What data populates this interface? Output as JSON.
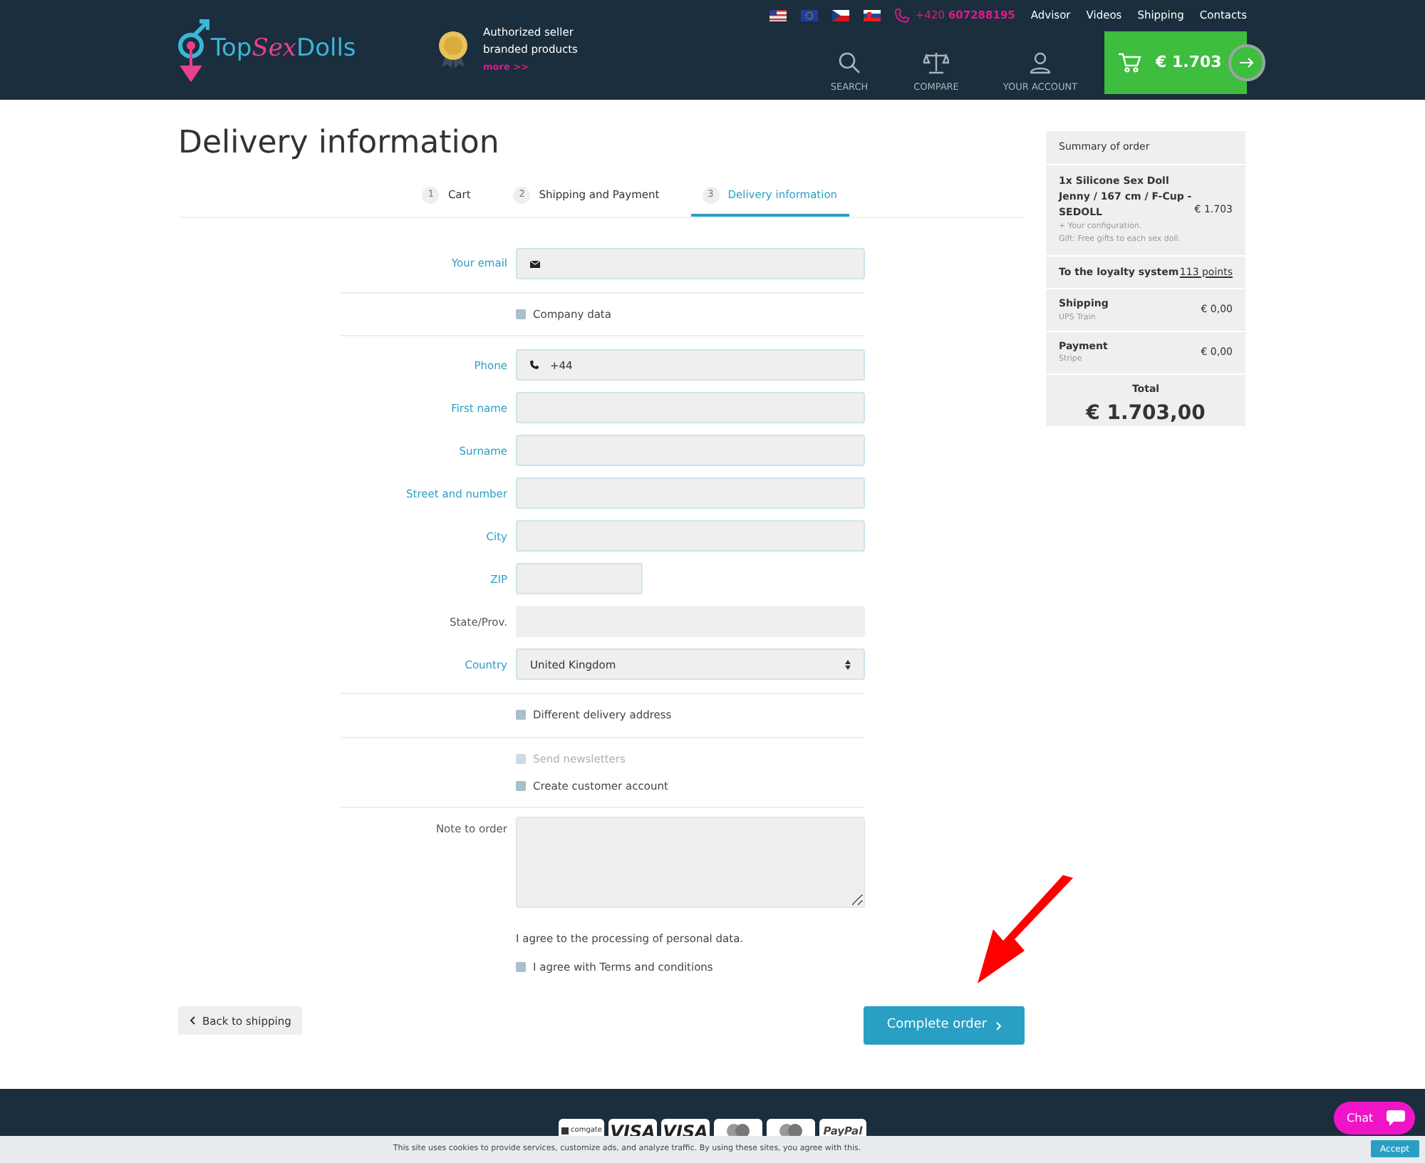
{
  "header": {
    "logo": [
      "Top",
      "Sex",
      "Dolls"
    ],
    "badge": {
      "lines": [
        "Authorized seller",
        "branded products"
      ],
      "link": "more >>"
    },
    "flags": [
      {
        "kind": "us"
      },
      {
        "kind": "eu"
      },
      {
        "kind": "cz"
      },
      {
        "kind": "sk"
      }
    ],
    "phone": {
      "prefix": "+420",
      "number": "607288195"
    },
    "nav_links": [
      "Advisor",
      "Videos",
      "Shipping",
      "Contacts"
    ],
    "actions": [
      {
        "kind": "search",
        "label": "SEARCH"
      },
      {
        "kind": "compare",
        "label": "COMPARE"
      },
      {
        "kind": "account",
        "label": "YOUR ACCOUNT"
      }
    ],
    "cart": {
      "total": "€ 1.703"
    }
  },
  "title": "Delivery information",
  "steps": [
    {
      "number": "1",
      "label": "Cart",
      "selected": false
    },
    {
      "number": "2",
      "label": "Shipping and Payment",
      "selected": false
    },
    {
      "number": "3",
      "label": "Delivery information",
      "selected": true
    }
  ],
  "form": [
    {
      "kind": "email",
      "label": "Your email",
      "required": true
    },
    {
      "kind": "divider"
    },
    {
      "kind": "checkbox",
      "label": "Company data",
      "checked": false,
      "disabled": false
    },
    {
      "kind": "divider"
    },
    {
      "kind": "phone",
      "label": "Phone",
      "required": true,
      "value": "+44"
    },
    {
      "kind": "input",
      "label": "First name",
      "required": true
    },
    {
      "kind": "input",
      "label": "Surname",
      "required": true
    },
    {
      "kind": "input",
      "label": "Street and number",
      "required": true
    },
    {
      "kind": "input",
      "label": "City",
      "required": true
    },
    {
      "kind": "short_input",
      "label": "ZIP",
      "required": true
    },
    {
      "kind": "input",
      "label": "State/Prov.",
      "required": false
    },
    {
      "kind": "select",
      "label": "Country",
      "required": true,
      "value": "United Kingdom"
    },
    {
      "kind": "divider"
    },
    {
      "kind": "checkbox",
      "label": "Different delivery address",
      "checked": false,
      "disabled": false
    },
    {
      "kind": "divider"
    },
    {
      "kind": "checkbox",
      "label": "Send newsletters",
      "checked": false,
      "disabled": true
    },
    {
      "kind": "checkbox",
      "label": "Create customer account",
      "checked": false,
      "disabled": false
    },
    {
      "kind": "divider"
    },
    {
      "kind": "textarea",
      "label": "Note to order",
      "required": false
    },
    {
      "kind": "text",
      "label": "I agree to the processing of personal data."
    },
    {
      "kind": "checkbox",
      "label": "I agree with Terms and conditions",
      "checked": false,
      "disabled": false
    }
  ],
  "buttons": {
    "back": "Back to shipping",
    "complete": "Complete order"
  },
  "summary": {
    "title": "Summary of order",
    "item": {
      "name": "1x Silicone Sex Doll Jenny / 167 cm / F-Cup - SEDOLL",
      "price": "€ 1.703",
      "notes": [
        "+ Your configuration.",
        "Gift: Free gifts to each sex doll."
      ]
    },
    "loyalty": {
      "label": "To the loyalty system",
      "points": "113 points"
    },
    "lines": [
      {
        "label": "Shipping",
        "method": "UPS Train",
        "price": "€ 0,00"
      },
      {
        "label": "Payment",
        "method": "Stripe",
        "price": "€ 0,00"
      }
    ],
    "total": {
      "label": "Total",
      "amount": "€ 1.703,00"
    }
  },
  "footer": {
    "payment_logos": [
      {
        "kind": "comgate",
        "label": "comgate"
      },
      {
        "kind": "visa",
        "label": "VISA"
      },
      {
        "kind": "visa",
        "label": "VISA"
      },
      {
        "kind": "circles"
      },
      {
        "kind": "circles"
      },
      {
        "kind": "paypal",
        "label": "PayPal"
      }
    ],
    "chat": "Chat"
  },
  "cookie_bar": {
    "text": "This site uses cookies to provide services, customize ads, and analyze traffic. By using these sites, you agree with this.",
    "button": "Accept"
  }
}
